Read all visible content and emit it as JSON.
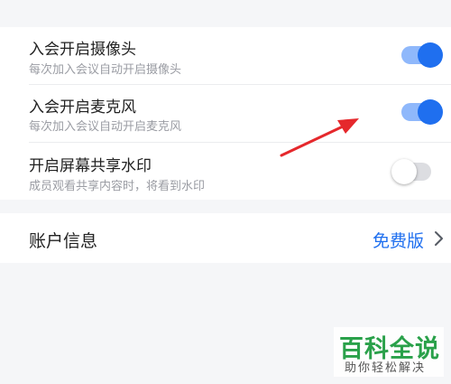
{
  "settings": {
    "camera_on_join": {
      "title": "入会开启摄像头",
      "desc": "每次加入会议自动开启摄像头",
      "enabled": true
    },
    "mic_on_join": {
      "title": "入会开启麦克风",
      "desc": "每次加入会议自动开启麦克风",
      "enabled": true
    },
    "share_watermark": {
      "title": "开启屏幕共享水印",
      "desc": "成员观看共享内容时，将看到水印",
      "enabled": false
    }
  },
  "account": {
    "label": "账户信息",
    "plan": "免费版"
  },
  "overlay": {
    "brand": "百科全说",
    "tagline": "助你轻松解决"
  },
  "colors": {
    "accent": "#1f6fef",
    "annotation_arrow": "#e5282c",
    "brand_green": "#2aa14a"
  }
}
